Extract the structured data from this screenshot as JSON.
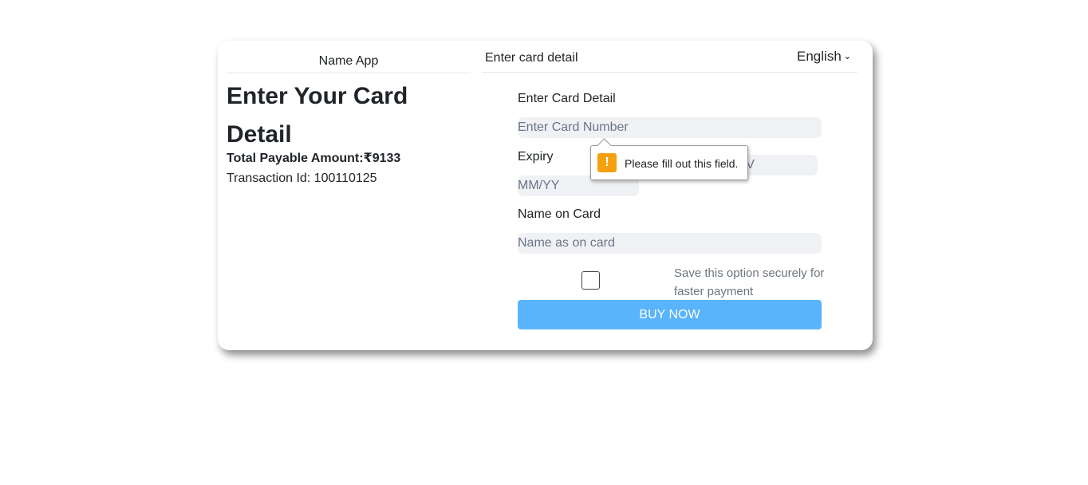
{
  "header": {
    "app_name": "Name App",
    "section_title": "Enter card detail",
    "language": "English"
  },
  "summary": {
    "title": "Enter Your Card Detail",
    "amount": "Total Payable Amount:₹9133",
    "transaction": "Transaction Id: 100110125"
  },
  "form": {
    "card_detail_label": "Enter Card Detail",
    "card_number_placeholder": "Enter Card Number",
    "expiry_label": "Expiry",
    "expiry_placeholder": "MM/YY",
    "cvv_placeholder": "CVV",
    "name_label": "Name on Card",
    "name_placeholder": "Name as on card",
    "save_text": "Save this option securely for faster payment",
    "buy_label": "BUY NOW"
  },
  "tooltip": {
    "message": "Please fill out this field.",
    "icon": "warning-icon",
    "icon_color": "#f5a00d"
  },
  "colors": {
    "button": "#59b4fb",
    "input_bg": "#eff1f4"
  }
}
